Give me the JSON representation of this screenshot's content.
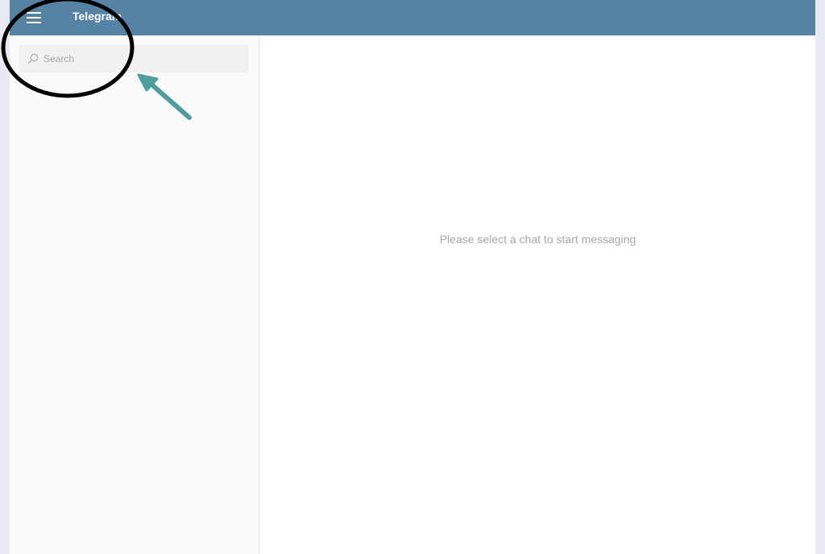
{
  "header": {
    "title": "Telegram",
    "menu_icon": "hamburger-menu-icon",
    "background_color": "#5682a3"
  },
  "sidebar": {
    "search": {
      "placeholder": "Search",
      "value": "",
      "icon": "search-icon"
    }
  },
  "main": {
    "empty_message": "Please select a chat to start messaging"
  },
  "annotations": {
    "highlight_circle_color": "#000000",
    "arrow_color": "#4f9e9e"
  }
}
